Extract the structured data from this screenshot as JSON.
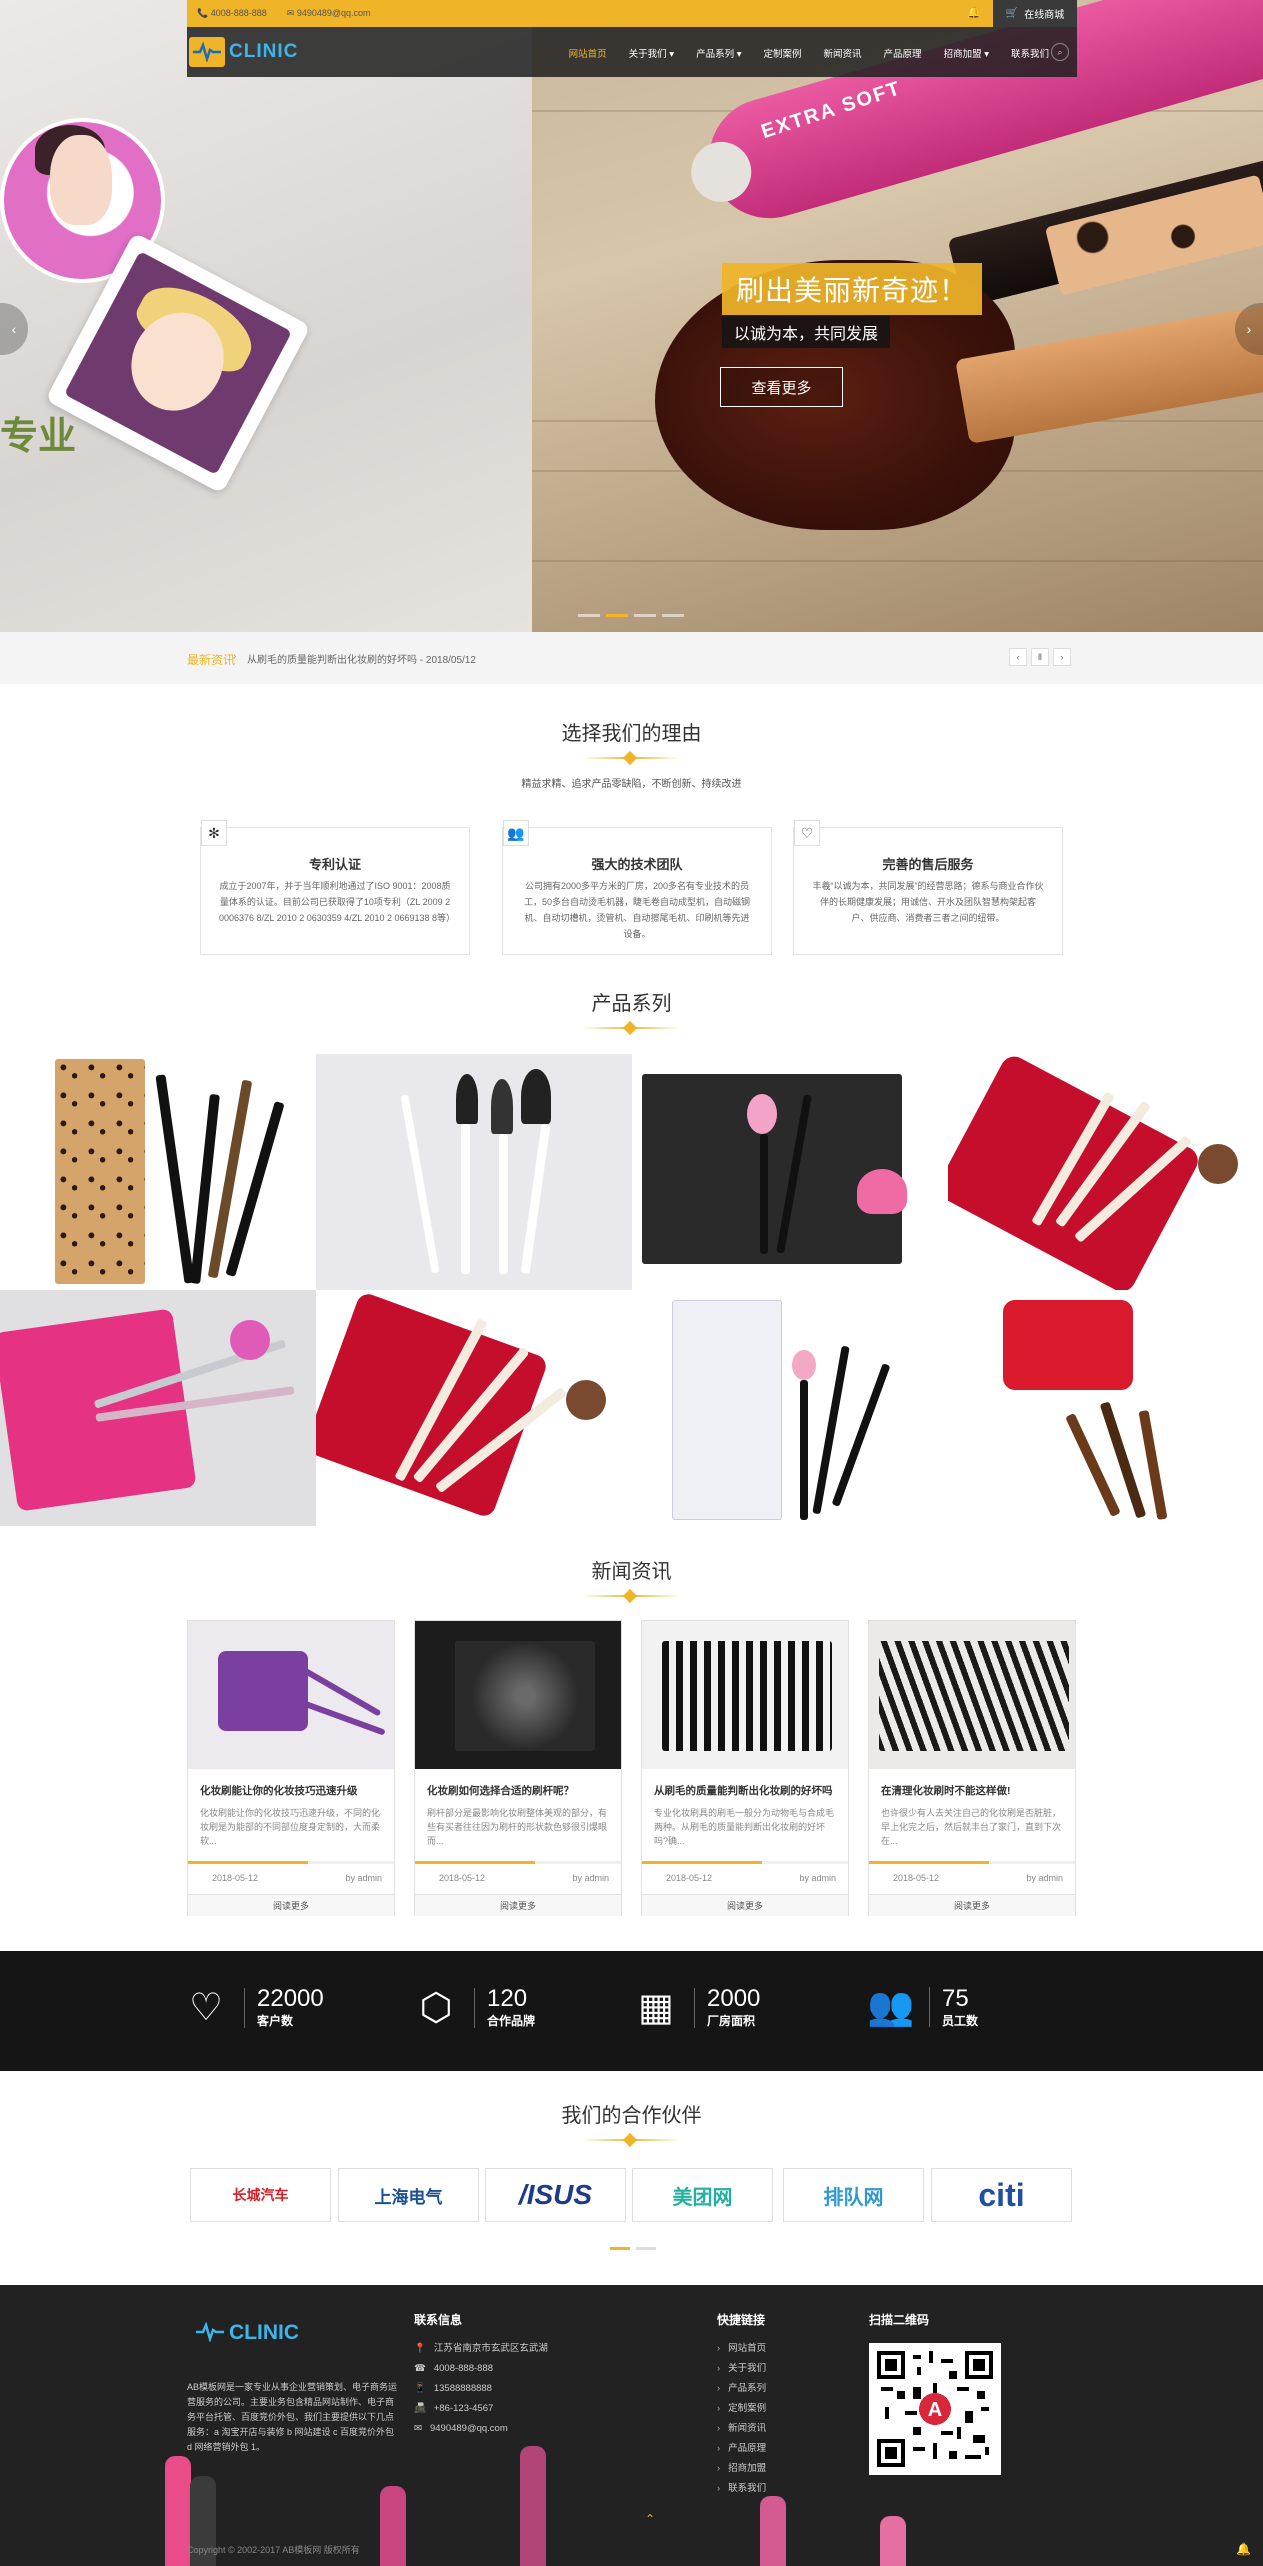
{
  "topbar": {
    "phone": "4008-888-888",
    "email": "9490489@qq.com",
    "shop": "在线商城"
  },
  "logo": {
    "text": "CLINIC"
  },
  "nav": [
    "网站首页",
    "关于我们 ▾",
    "产品系列 ▾",
    "定制案例",
    "新闻资讯",
    "产品原理",
    "招商加盟 ▾",
    "联系我们"
  ],
  "hero": {
    "left_slogan": "专业",
    "tube_text": "EXTRA SOFT",
    "title": "刷出美丽新奇迹！",
    "subtitle": "以诚为本，共同发展",
    "button": "查看更多",
    "prev": "‹",
    "next": "›"
  },
  "ticker": {
    "label": "最新资讯",
    "text": "从刷毛的质量能判断出化妆刷的好坏吗 - 2018/05/12",
    "controls": [
      "‹",
      "Ⅱ",
      "›"
    ]
  },
  "why": {
    "title": "选择我们的理由",
    "subtitle": "精益求精、追求产品零缺陷，不断创新、持续改进",
    "items": [
      {
        "title": "专利认证",
        "text": "成立于2007年，并于当年顺利地通过了ISO 9001：2008质量体系的认证。目前公司已获取得了10项专利（ZL 2009 2 0006376 8/ZL 2010 2 0630359 4/ZL 2010 2 0669138 8等）",
        "icon": "✻"
      },
      {
        "title": "强大的技术团队",
        "text": "公司拥有2000多平方米的厂房，200多名有专业技术的员工，50多台自动烫毛机器，睫毛卷自动成型机，自动磁钢机、自动切槽机，烫管机、自动擦尾毛机、印刷机等先进设备。",
        "icon": "👥"
      },
      {
        "title": "完善的售后服务",
        "text": "丰羲“以诚为本，共同发展”的经营思路；德系与商业合作伙伴的长期健康发展；用诚信、开水及团队智慧构架起客户、供应商、消费者三者之间的纽带。",
        "icon": "♡"
      }
    ]
  },
  "products": {
    "title": "产品系列"
  },
  "news": {
    "title": "新闻资讯",
    "items": [
      {
        "title": "化妆刷能让你的化妆技巧迅速升级",
        "text": "化妆刷能让你的化妆技巧迅速升级，不同的化妆刷是为能部的不同部位度身定制的，大而柔软...",
        "date": "2018-05-12",
        "author": "by admin",
        "more": "阅读更多"
      },
      {
        "title": "化妆刷如何选择合适的刷杆呢？",
        "text": "刷杆部分是最影响化妆刷整体美观的部分，有些有买者往往因为刷杆的形状款色够很引爆眼而...",
        "date": "2018-05-12",
        "author": "by admin",
        "more": "阅读更多"
      },
      {
        "title": "从刷毛的质量能判断出化妆刷的好坏吗",
        "text": "专业化妆刷具的刷毛一般分为动物毛与合成毛两种。从刷毛的质量能判断出化妆刷的好坏吗?确...",
        "date": "2018-05-12",
        "author": "by admin",
        "more": "阅读更多"
      },
      {
        "title": "在清理化妆刷时不能这样做!",
        "text": "也许很少有人去关注自己的化妆刷是否脏脏，早上化完之后，然后就丰台了家门，直到下次在...",
        "date": "2018-05-12",
        "author": "by admin",
        "more": "阅读更多"
      }
    ]
  },
  "stats": [
    {
      "num": "22000",
      "label": "客户数",
      "icon": "♡"
    },
    {
      "num": "120",
      "label": "合作品牌",
      "icon": "⬡"
    },
    {
      "num": "2000",
      "label": "厂房面积",
      "icon": "▦"
    },
    {
      "num": "75",
      "label": "员工数",
      "icon": "👥"
    }
  ],
  "partners": {
    "title": "我们的合作伙伴",
    "items": [
      {
        "name": "长城汽车",
        "color": "#d21f27"
      },
      {
        "name": "上海电气",
        "color": "#1d4f91"
      },
      {
        "name": "/ISUS",
        "color": "#1e3a8a"
      },
      {
        "name": "美团网",
        "color": "#23b0a3"
      },
      {
        "name": "排队网",
        "color": "#2e9ad0"
      },
      {
        "name": "citi",
        "color": "#1e4fa0"
      }
    ]
  },
  "footer": {
    "about": "AB模板网是一家专业从事企业营销策划、电子商务运营服务的公司。主要业务包含精品网站制作、电子商务平台托管、百度竞价外包、我们主要提供以下几点服务：a 淘宝开店与装修 b 网站建设 c 百度竞价外包 d 网络营销外包 1。",
    "contact_title": "联系信息",
    "contact": [
      {
        "icon": "📍",
        "text": "江苏省南京市玄武区玄武湖"
      },
      {
        "icon": "☎",
        "text": "4008-888-888"
      },
      {
        "icon": "📱",
        "text": "13588888888"
      },
      {
        "icon": "📠",
        "text": "+86-123-4567"
      },
      {
        "icon": "✉",
        "text": "9490489@qq.com"
      }
    ],
    "links_title": "快捷链接",
    "links": [
      "网站首页",
      "关于我们",
      "产品系列",
      "定制案例",
      "新闻资讯",
      "产品原理",
      "招商加盟",
      "联系我们"
    ],
    "qr_title": "扫描二维码",
    "copyright": "Copyright © 2002-2017 AB模板网 版权所有"
  }
}
